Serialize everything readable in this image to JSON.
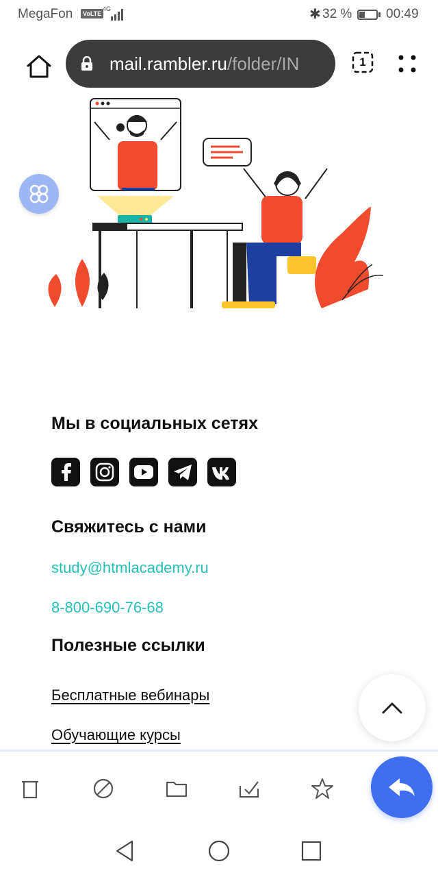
{
  "status_bar": {
    "carrier": "MegaFon",
    "volte": "VoLTE",
    "network": "4G",
    "battery_pct": "32 %",
    "battery_level": 0.32,
    "time": "00:49"
  },
  "browser": {
    "url_domain": "mail.rambler.ru",
    "url_path": "/folder/IN",
    "tabs_count": "1"
  },
  "footer": {
    "social_title": "Мы в социальных сетях",
    "social_icons": [
      "facebook-icon",
      "instagram-icon",
      "youtube-icon",
      "telegram-icon",
      "vk-icon"
    ],
    "contact_title": "Свяжитесь с нами",
    "email": "study@htmlacademy.ru",
    "phone": "8-800-690-76-68",
    "links_title": "Полезные ссылки",
    "links": [
      "Бесплатные вебинары",
      "Обучающие курсы"
    ]
  },
  "toolbar": {
    "icons": [
      "trash-icon",
      "spam-icon",
      "folder-icon",
      "mark-read-icon",
      "star-icon"
    ],
    "reply_icon": "reply-icon"
  },
  "navbar": {
    "icons": [
      "back-icon",
      "home-icon",
      "recents-icon"
    ]
  },
  "colors": {
    "accent": "#25c0b7",
    "reply_button": "#3f6fef",
    "apps_button": "#9db7f5",
    "url_bar": "#3c3c3c",
    "illustration_red": "#f04b2f"
  }
}
